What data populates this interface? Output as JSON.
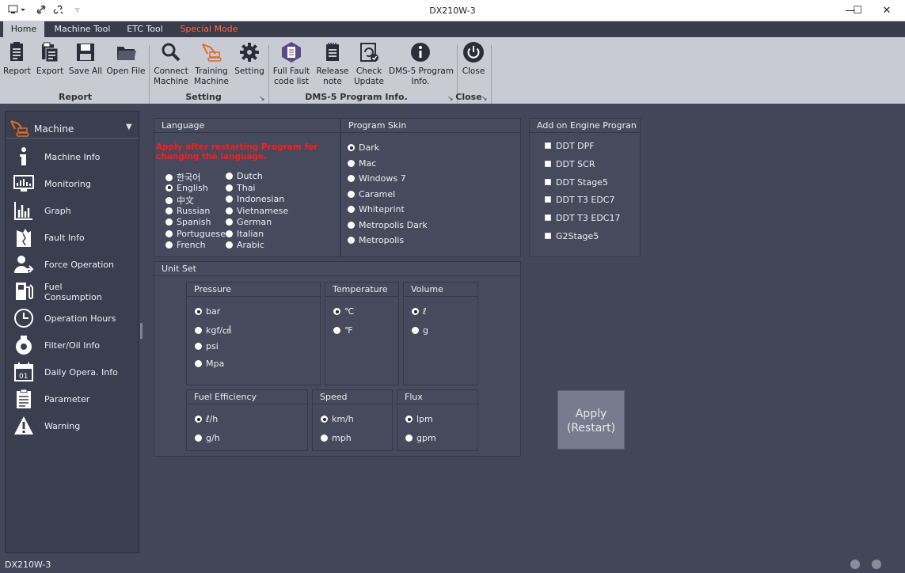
{
  "window": {
    "title": "DX210W-3",
    "minimize": "—",
    "maximize": "☐",
    "close": "✕"
  },
  "tabs": [
    {
      "label": "Home"
    },
    {
      "label": "Machine Tool"
    },
    {
      "label": "ETC Tool"
    },
    {
      "label": "Special Mode"
    }
  ],
  "ribbon": {
    "buttons": [
      {
        "label": "Report",
        "icon": "report-icon"
      },
      {
        "label": "Export",
        "icon": "export-icon"
      },
      {
        "label": "Save All",
        "icon": "save-icon"
      },
      {
        "label": "Open File",
        "icon": "folder-icon"
      },
      {
        "label": "Connect\nMachine",
        "icon": "search-icon"
      },
      {
        "label": "Training\nMachine",
        "icon": "excavator-icon"
      },
      {
        "label": "Setting",
        "icon": "gear-icon"
      },
      {
        "label": "Full Fault\ncode list",
        "icon": "clipboard-icon"
      },
      {
        "label": "Release\nnote",
        "icon": "notepad-icon"
      },
      {
        "label": "Check\nUpdate",
        "icon": "update-icon"
      },
      {
        "label": "DMS-5 Program\nInfo.",
        "icon": "info-icon"
      },
      {
        "label": "Close",
        "icon": "power-icon"
      }
    ],
    "groups": [
      "Report",
      "Setting",
      "DMS-5 Program Info.",
      "Close"
    ]
  },
  "sidebar": {
    "header": "Machine",
    "items": [
      {
        "label": "Machine Info",
        "icon": "info-icon"
      },
      {
        "label": "Monitoring",
        "icon": "monitor-icon"
      },
      {
        "label": "Graph",
        "icon": "graph-icon"
      },
      {
        "label": "Fault Info",
        "icon": "fault-icon"
      },
      {
        "label": "Force Operation",
        "icon": "person-icon"
      },
      {
        "label": "Fuel\nConsumption",
        "icon": "fuel-icon"
      },
      {
        "label": "Operation Hours",
        "icon": "clock-icon"
      },
      {
        "label": "Filter/Oil Info",
        "icon": "oil-icon"
      },
      {
        "label": "Daily Opera. Info",
        "icon": "calendar-icon"
      },
      {
        "label": "Parameter",
        "icon": "list-icon"
      },
      {
        "label": "Warning",
        "icon": "warning-icon"
      }
    ]
  },
  "language": {
    "header": "Language",
    "warning": "Apply after restarting Program for changing the language.",
    "col1": [
      "한국어",
      "English",
      "中文",
      "Russian",
      "Spanish",
      "Portuguese",
      "French"
    ],
    "col2": [
      "Dutch",
      "Thai",
      "Indonesian",
      "Vietnamese",
      "German",
      "Italian",
      "Arabic"
    ],
    "selected": "English"
  },
  "skin": {
    "header": "Program Skin",
    "options": [
      "Dark",
      "Mac",
      "Windows 7",
      "Caramel",
      "Whiteprint",
      "Metropolis Dark",
      "Metropolis"
    ],
    "selected": "Dark"
  },
  "engine": {
    "header": "Add on Engine Progran",
    "options": [
      "DDT DPF",
      "DDT SCR",
      "DDT Stage5",
      "DDT T3 EDC7",
      "DDT T3 EDC17",
      "G2Stage5"
    ]
  },
  "unitset": {
    "header": "Unit Set",
    "pressure": {
      "header": "Pressure",
      "options": [
        "bar",
        "kgf/㎠",
        "psi",
        "Mpa"
      ],
      "selected": "bar"
    },
    "temperature": {
      "header": "Temperature",
      "options": [
        "℃",
        "℉"
      ],
      "selected": "℃"
    },
    "volume": {
      "header": "Volume",
      "options": [
        "ℓ",
        "g"
      ],
      "selected": "ℓ"
    },
    "fuel": {
      "header": "Fuel Efficiency",
      "options": [
        "ℓ/h",
        "g/h"
      ],
      "selected": "ℓ/h"
    },
    "speed": {
      "header": "Speed",
      "options": [
        "km/h",
        "mph"
      ],
      "selected": "km/h"
    },
    "flux": {
      "header": "Flux",
      "options": [
        "lpm",
        "gpm"
      ],
      "selected": "lpm"
    }
  },
  "apply": {
    "line1": "Apply",
    "line2": "(Restart)"
  },
  "status": {
    "text": "DX210W-3"
  },
  "colors": {
    "background": "#434658",
    "ribbon": "#c8cad4",
    "special_tab": "#ff6a3c",
    "warning_text": "#ff1a1a"
  }
}
